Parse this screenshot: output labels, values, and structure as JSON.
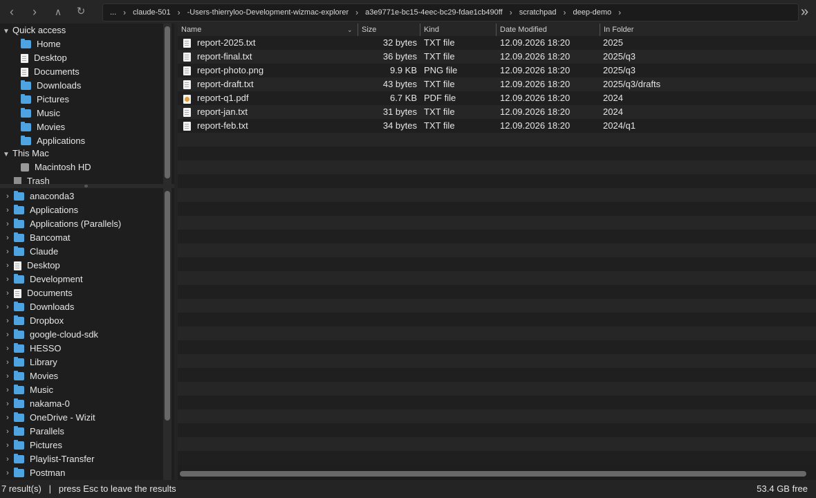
{
  "toolbar": {
    "back_icon": "chevron-left-icon",
    "forward_icon": "chevron-right-icon",
    "up_icon": "caret-up-icon",
    "reload_icon": "reload-icon",
    "expand_icon": "double-chevron-right-icon",
    "breadcrumbs": [
      "...",
      "claude-501",
      "-Users-thierryloo-Development-wizmac-explorer",
      "a3e9771e-bc15-4eec-bc29-fdae1cb490ff",
      "scratchpad",
      "deep-demo"
    ]
  },
  "sidebar": {
    "quick_access_label": "Quick access",
    "quick_access_items": [
      {
        "label": "Home",
        "icon": "folder-icon"
      },
      {
        "label": "Desktop",
        "icon": "document-icon"
      },
      {
        "label": "Documents",
        "icon": "document-icon"
      },
      {
        "label": "Downloads",
        "icon": "folder-icon"
      },
      {
        "label": "Pictures",
        "icon": "folder-icon"
      },
      {
        "label": "Music",
        "icon": "folder-icon"
      },
      {
        "label": "Movies",
        "icon": "folder-icon"
      },
      {
        "label": "Applications",
        "icon": "folder-icon"
      }
    ],
    "this_mac_label": "This Mac",
    "this_mac_items": [
      {
        "label": "Macintosh HD",
        "icon": "disk-icon"
      },
      {
        "label": "Trash",
        "icon": "trash-icon"
      }
    ]
  },
  "tree": {
    "items": [
      {
        "label": "anaconda3",
        "icon": "folder-icon"
      },
      {
        "label": "Applications",
        "icon": "folder-icon"
      },
      {
        "label": "Applications (Parallels)",
        "icon": "folder-icon"
      },
      {
        "label": "Bancomat",
        "icon": "folder-icon"
      },
      {
        "label": "Claude",
        "icon": "folder-icon"
      },
      {
        "label": "Desktop",
        "icon": "document-icon"
      },
      {
        "label": "Development",
        "icon": "folder-icon"
      },
      {
        "label": "Documents",
        "icon": "document-icon"
      },
      {
        "label": "Downloads",
        "icon": "folder-icon"
      },
      {
        "label": "Dropbox",
        "icon": "folder-icon"
      },
      {
        "label": "google-cloud-sdk",
        "icon": "folder-icon"
      },
      {
        "label": "HESSO",
        "icon": "folder-icon"
      },
      {
        "label": "Library",
        "icon": "folder-icon"
      },
      {
        "label": "Movies",
        "icon": "folder-icon"
      },
      {
        "label": "Music",
        "icon": "folder-icon"
      },
      {
        "label": "nakama-0",
        "icon": "folder-icon"
      },
      {
        "label": "OneDrive - Wizit",
        "icon": "folder-icon"
      },
      {
        "label": "Parallels",
        "icon": "folder-icon"
      },
      {
        "label": "Pictures",
        "icon": "folder-icon"
      },
      {
        "label": "Playlist-Transfer",
        "icon": "folder-icon"
      },
      {
        "label": "Postman",
        "icon": "folder-icon"
      }
    ]
  },
  "table": {
    "columns": {
      "name": "Name",
      "size": "Size",
      "kind": "Kind",
      "date": "Date Modified",
      "folder": "In Folder"
    },
    "rows": [
      {
        "name": "report-2025.txt",
        "size": "32 bytes",
        "kind": "TXT file",
        "date": "12.09.2026 18:20",
        "folder": "2025",
        "icon": "text-file-icon"
      },
      {
        "name": "report-final.txt",
        "size": "36 bytes",
        "kind": "TXT file",
        "date": "12.09.2026 18:20",
        "folder": "2025/q3",
        "icon": "text-file-icon"
      },
      {
        "name": "report-photo.png",
        "size": "9.9 KB",
        "kind": "PNG file",
        "date": "12.09.2026 18:20",
        "folder": "2025/q3",
        "icon": "image-file-icon"
      },
      {
        "name": "report-draft.txt",
        "size": "43 bytes",
        "kind": "TXT file",
        "date": "12.09.2026 18:20",
        "folder": "2025/q3/drafts",
        "icon": "text-file-icon"
      },
      {
        "name": "report-q1.pdf",
        "size": "6.7 KB",
        "kind": "PDF file",
        "date": "12.09.2026 18:20",
        "folder": "2024",
        "icon": "pdf-file-icon"
      },
      {
        "name": "report-jan.txt",
        "size": "31 bytes",
        "kind": "TXT file",
        "date": "12.09.2026 18:20",
        "folder": "2024",
        "icon": "text-file-icon"
      },
      {
        "name": "report-feb.txt",
        "size": "34 bytes",
        "kind": "TXT file",
        "date": "12.09.2026 18:20",
        "folder": "2024/q1",
        "icon": "text-file-icon"
      }
    ]
  },
  "status": {
    "results": "7 result(s)",
    "separator": "|",
    "hint": "press Esc to leave the results",
    "free_space": "53.4 GB free"
  },
  "colors": {
    "background": "#1e1e1e",
    "folder_accent": "#4fa3e0"
  }
}
